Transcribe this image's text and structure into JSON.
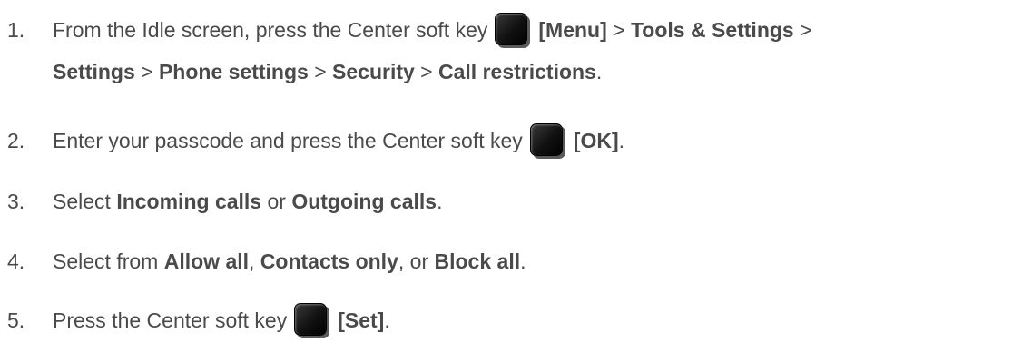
{
  "steps": [
    {
      "number": "1.",
      "line1": {
        "a": "From the Idle screen, press the Center soft key",
        "b": "[Menu]",
        "c": " > ",
        "d": "Tools & Settings",
        "e": " >"
      },
      "line2": {
        "a": "Settings",
        "b": " > ",
        "c": "Phone settings",
        "d": " > ",
        "e": "Security",
        "f": " > ",
        "g": "Call restrictions",
        "h": "."
      }
    },
    {
      "number": "2.",
      "a": "Enter your passcode and press the Center soft key",
      "b": "[OK]",
      "c": "."
    },
    {
      "number": "3.",
      "a": "Select ",
      "b": "Incoming calls",
      "c": " or ",
      "d": "Outgoing calls",
      "e": "."
    },
    {
      "number": "4.",
      "a": "Select from ",
      "b": "Allow all",
      "c": ", ",
      "d": "Contacts only",
      "e": ", or ",
      "f": "Block all",
      "g": "."
    },
    {
      "number": "5.",
      "a": "Press the Center soft key",
      "b": "[Set]",
      "c": "."
    }
  ],
  "icons": {
    "center_soft_key": "center-soft-key-icon"
  }
}
